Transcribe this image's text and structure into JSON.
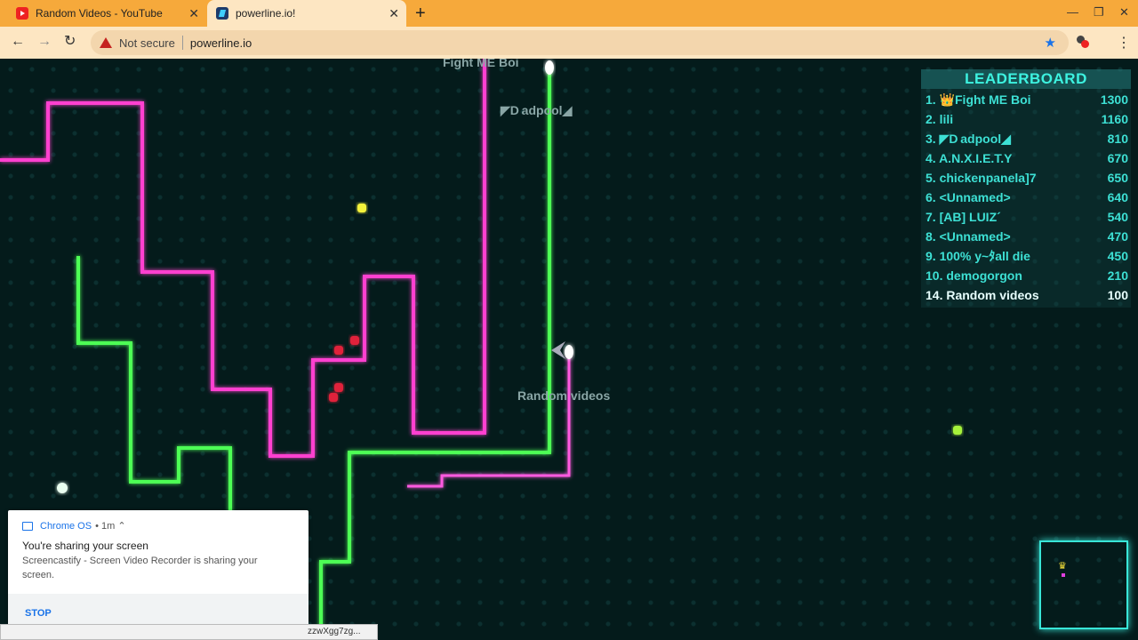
{
  "tabs": [
    {
      "title": "Random Videos - YouTube",
      "icon": "youtube-icon",
      "active": false
    },
    {
      "title": "powerline.io!",
      "icon": "powerline-icon",
      "active": true
    }
  ],
  "toolbar": {
    "security_label": "Not secure",
    "url": "powerline.io"
  },
  "game": {
    "players": [
      {
        "name": "Fight ME Boi"
      },
      {
        "name": "◤D adpool◢"
      },
      {
        "name": "Random videos"
      }
    ],
    "leaderboard": {
      "title": "LEADERBOARD",
      "rows": [
        {
          "rank": "1.",
          "name": "👑Fight ME Boi",
          "score": "1300"
        },
        {
          "rank": "2.",
          "name": "lili",
          "score": "1160"
        },
        {
          "rank": "3.",
          "name": "◤D adpool◢",
          "score": "810"
        },
        {
          "rank": "4.",
          "name": "A.N.X.I.E.T.Y",
          "score": "670"
        },
        {
          "rank": "5.",
          "name": "chickenpanela]7",
          "score": "650"
        },
        {
          "rank": "6.",
          "name": "<Unnamed>",
          "score": "640"
        },
        {
          "rank": "7.",
          "name": "[AB] LUIZ´",
          "score": "540"
        },
        {
          "rank": "8.",
          "name": "<Unnamed>",
          "score": "470"
        },
        {
          "rank": "9.",
          "name": "100% y~ﾀall die",
          "score": "450"
        },
        {
          "rank": "10.",
          "name": "demogorgon",
          "score": "210"
        },
        {
          "rank": "14.",
          "name": "Random videos",
          "score": "100"
        }
      ]
    }
  },
  "notification": {
    "source": "Chrome OS",
    "time": "• 1m ⌃",
    "title": "You're sharing your screen",
    "body": "Screencastify - Screen Video Recorder is sharing your screen.",
    "action": "STOP"
  },
  "status_url": "zzwXgg7zg..."
}
